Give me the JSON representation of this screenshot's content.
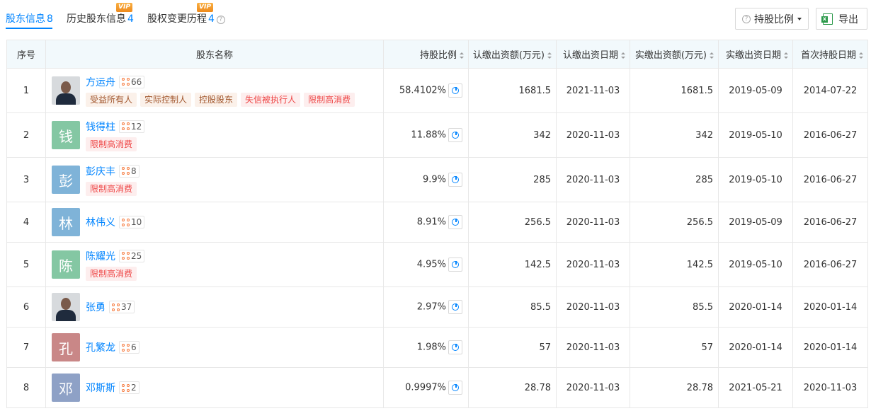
{
  "tabs": [
    {
      "label": "股东信息",
      "count": "8",
      "vip": false
    },
    {
      "label": "历史股东信息",
      "count": "4",
      "vip": true
    },
    {
      "label": "股权变更历程",
      "count": "4",
      "vip": true
    }
  ],
  "vip_badge": "VIP",
  "help_icon": "?",
  "filter_button": {
    "label": "持股比例"
  },
  "export_button": {
    "label": "导出"
  },
  "table": {
    "headers": {
      "index": "序号",
      "name": "股东名称",
      "ratio": "持股比例",
      "subscribed_amount": "认缴出资额(万元)",
      "subscribed_date": "认缴出资日期",
      "paid_amount": "实缴出资额(万元)",
      "paid_date": "实缴出资日期",
      "first_date": "首次持股日期"
    },
    "rows": [
      {
        "index": "1",
        "name": "方运舟",
        "avatar": "",
        "avatar_type": "photo",
        "related": "66",
        "tags": [
          "受益所有人",
          "实际控制人",
          "控股股东",
          "失信被执行人",
          "限制高消费"
        ],
        "ratio": "58.4102%",
        "subscribed_amount": "1681.5",
        "subscribed_date": "2021-11-03",
        "paid_amount": "1681.5",
        "paid_date": "2019-05-09",
        "first_date": "2014-07-22"
      },
      {
        "index": "2",
        "name": "钱得柱",
        "avatar": "钱",
        "avatar_type": "text",
        "avatar_color": "#84c7a3",
        "related": "12",
        "tags": [
          "限制高消费"
        ],
        "ratio": "11.88%",
        "subscribed_amount": "342",
        "subscribed_date": "2020-11-03",
        "paid_amount": "342",
        "paid_date": "2019-05-10",
        "first_date": "2016-06-27"
      },
      {
        "index": "3",
        "name": "彭庆丰",
        "avatar": "彭",
        "avatar_type": "text",
        "avatar_color": "#7fb3d8",
        "related": "8",
        "tags": [
          "限制高消费"
        ],
        "ratio": "9.9%",
        "subscribed_amount": "285",
        "subscribed_date": "2020-11-03",
        "paid_amount": "285",
        "paid_date": "2019-05-10",
        "first_date": "2016-06-27"
      },
      {
        "index": "4",
        "name": "林伟义",
        "avatar": "林",
        "avatar_type": "text",
        "avatar_color": "#7fb3d8",
        "related": "10",
        "tags": [],
        "ratio": "8.91%",
        "subscribed_amount": "256.5",
        "subscribed_date": "2020-11-03",
        "paid_amount": "256.5",
        "paid_date": "2019-05-09",
        "first_date": "2016-06-27"
      },
      {
        "index": "5",
        "name": "陈耀光",
        "avatar": "陈",
        "avatar_type": "text",
        "avatar_color": "#84c7a3",
        "related": "25",
        "tags": [
          "限制高消费"
        ],
        "ratio": "4.95%",
        "subscribed_amount": "142.5",
        "subscribed_date": "2020-11-03",
        "paid_amount": "142.5",
        "paid_date": "2019-05-10",
        "first_date": "2016-06-27"
      },
      {
        "index": "6",
        "name": "张勇",
        "avatar": "",
        "avatar_type": "photo",
        "related": "37",
        "tags": [],
        "ratio": "2.97%",
        "subscribed_amount": "85.5",
        "subscribed_date": "2020-11-03",
        "paid_amount": "85.5",
        "paid_date": "2020-01-14",
        "first_date": "2020-01-14"
      },
      {
        "index": "7",
        "name": "孔繁龙",
        "avatar": "孔",
        "avatar_type": "text",
        "avatar_color": "#c98787",
        "related": "6",
        "tags": [],
        "ratio": "1.98%",
        "subscribed_amount": "57",
        "subscribed_date": "2020-11-03",
        "paid_amount": "57",
        "paid_date": "2020-01-14",
        "first_date": "2020-01-14"
      },
      {
        "index": "8",
        "name": "邓斯斯",
        "avatar": "邓",
        "avatar_type": "text",
        "avatar_color": "#8ea1c6",
        "related": "2",
        "tags": [],
        "ratio": "0.9997%",
        "subscribed_amount": "28.78",
        "subscribed_date": "2020-11-03",
        "paid_amount": "28.78",
        "paid_date": "2021-05-21",
        "first_date": "2020-11-03"
      }
    ]
  },
  "colors": {
    "accent": "#0084ff",
    "header_bg": "#f2f9fc",
    "tag_brown": "#a0542a",
    "tag_red": "#ee4646",
    "vip": "#f39a2c"
  }
}
